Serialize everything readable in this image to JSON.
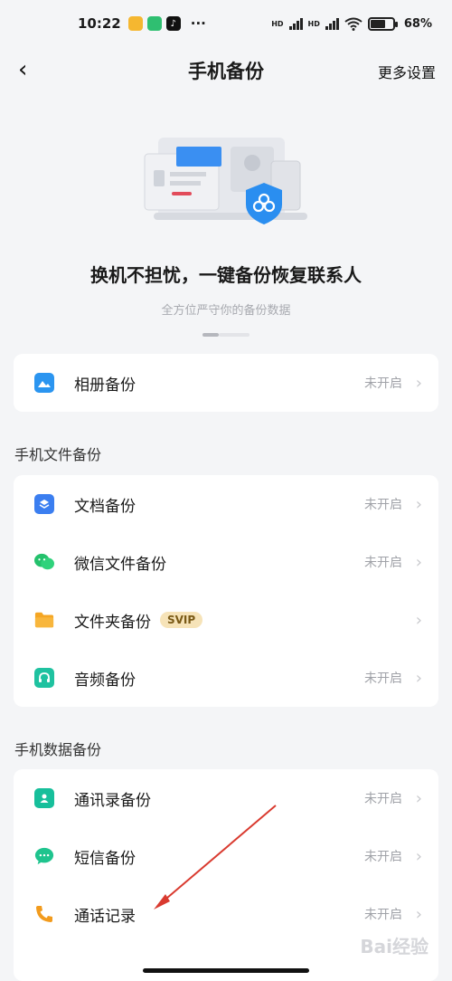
{
  "status": {
    "time": "10:22",
    "battery": "68%",
    "net1": "HD",
    "net2": "HD"
  },
  "nav": {
    "title": "手机备份",
    "more": "更多设置",
    "back_icon": "‹"
  },
  "hero": {
    "headline": "换机不担忧，一键备份恢复联系人",
    "subtitle": "全方位严守你的备份数据"
  },
  "album": {
    "label": "相册备份",
    "state": "未开启"
  },
  "files_section": {
    "title": "手机文件备份",
    "items": [
      {
        "label": "文档备份",
        "state": "未开启"
      },
      {
        "label": "微信文件备份",
        "state": "未开启"
      },
      {
        "label": "文件夹备份",
        "state": "",
        "badge": "SVIP"
      },
      {
        "label": "音频备份",
        "state": "未开启"
      }
    ]
  },
  "data_section": {
    "title": "手机数据备份",
    "items": [
      {
        "label": "通讯录备份",
        "state": "未开启"
      },
      {
        "label": "短信备份",
        "state": "未开启"
      },
      {
        "label": "通话记录",
        "state": "未开启"
      }
    ]
  },
  "chevron": "›",
  "watermark": "Bai经验",
  "colors": {
    "accent": "#1e8bf0",
    "arrow": "#d93a2f"
  }
}
